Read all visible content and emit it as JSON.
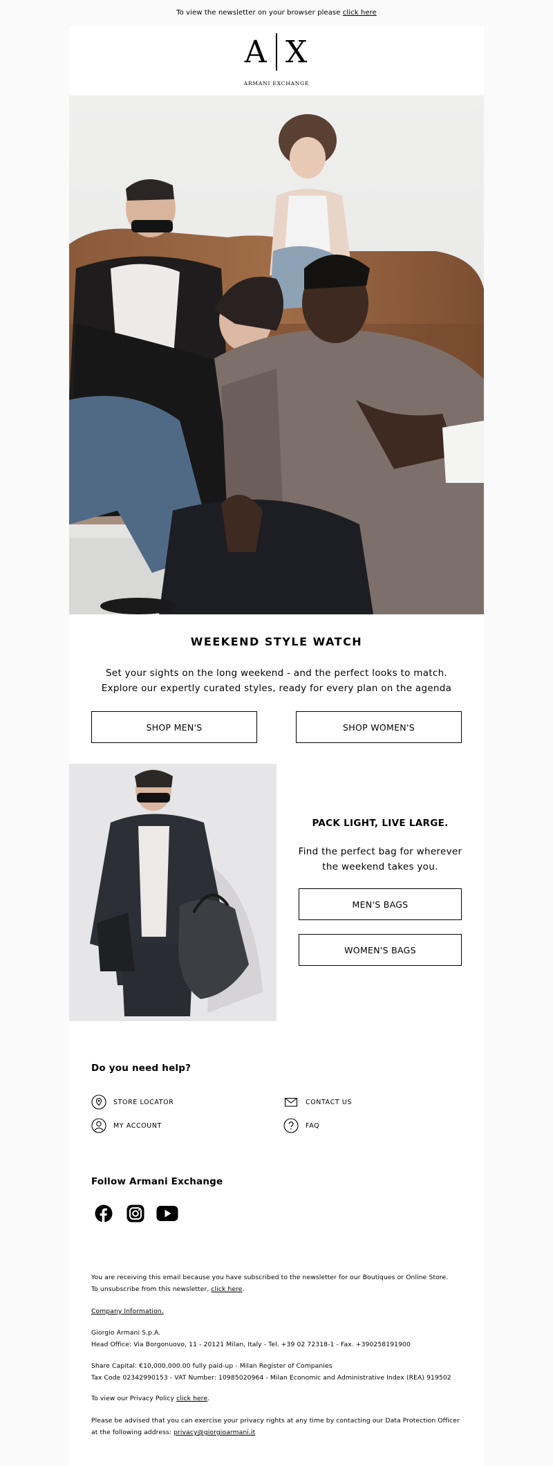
{
  "top_bar": {
    "text": "To view the newsletter on your browser please",
    "link": "click here"
  },
  "brand": {
    "mark_left": "A",
    "mark_right": "X",
    "name": "ARMANI EXCHANGE"
  },
  "hero": {
    "title": "WEEKEND STYLE WATCH",
    "description": "Set your sights on the long weekend - and the perfect looks to match. Explore our expertly curated styles, ready for every plan on the agenda",
    "buttons": [
      "SHOP MEN'S",
      "SHOP WOMEN'S"
    ]
  },
  "promo": {
    "title": "PACK LIGHT, LIVE LARGE.",
    "description": "Find the perfect bag for wherever the weekend takes you.",
    "buttons": [
      "MEN'S BAGS",
      "WOMEN'S BAGS"
    ]
  },
  "help": {
    "title": "Do you need help?",
    "items": [
      {
        "label": "STORE LOCATOR",
        "icon": "location-pin-icon"
      },
      {
        "label": "CONTACT US",
        "icon": "envelope-icon"
      },
      {
        "label": "MY ACCOUNT",
        "icon": "user-icon"
      },
      {
        "label": "FAQ",
        "icon": "question-icon"
      }
    ]
  },
  "follow": {
    "title": "Follow Armani Exchange",
    "icons": [
      "facebook-icon",
      "instagram-icon",
      "youtube-icon"
    ]
  },
  "footer": {
    "subscribed": "You are receiving this email because you have subscribed to the newsletter for our Boutiques or Online Store.",
    "unsubscribe_text": "To unsubscribe from this newsletter,",
    "unsubscribe_link": "click here",
    "company_info_link": "Company Information.",
    "company_name": "Giorgio Armani S.p.A.",
    "head_office": "Head Office: Via Borgonuovo, 11 - 20121 Milan, Italy - Tel. +39 02 72318-1 - Fax. +390258191900",
    "share_capital": "Share Capital: €10,000,000.00 fully paid-up - Milan Register of Companies",
    "tax_code": "Tax Code 02342990153 - VAT Number: 10985020964 - Milan Economic and Administrative Index (REA) 919502",
    "privacy_text": "To view our Privacy Policy",
    "privacy_link": "click here",
    "dpo_text": "Please be advised that you can exercise your privacy rights at any time by contacting our Data Protection Officer at the following address:",
    "dpo_email": "privacy@giorgioarmani.it"
  },
  "colors": {
    "page_background": "#fafafa",
    "card_background": "#ffffff",
    "text": "#000000"
  }
}
